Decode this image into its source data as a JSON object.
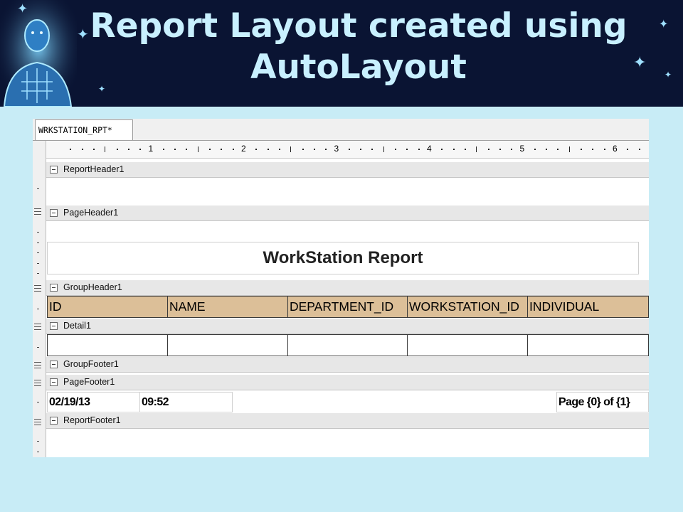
{
  "slide": {
    "title_line1": "Report Layout  created using",
    "title_line2": "AutoLayout",
    "decoration_icon": "robot-figure-icon",
    "accent_color": "#c8f0ff",
    "banner_color": "#0a1433"
  },
  "designer": {
    "tab_label": "WRKSTATION_RPT*",
    "ruler_numbers": [
      "1",
      "2",
      "3",
      "4",
      "5",
      "6"
    ],
    "bands": {
      "report_header": "ReportHeader1",
      "page_header": "PageHeader1",
      "group_header": "GroupHeader1",
      "detail": "Detail1",
      "group_footer": "GroupFooter1",
      "page_footer": "PageFooter1",
      "report_footer": "ReportFooter1"
    },
    "report_title": "WorkStation Report",
    "columns": [
      "ID",
      "NAME",
      "DEPARTMENT_ID",
      "WORKSTATION_ID",
      "INDIVIDUAL"
    ],
    "header_color": "#dcbf98",
    "footer": {
      "date": "02/19/13",
      "time": "09:52",
      "page_text": "Page {0} of {1}"
    }
  }
}
